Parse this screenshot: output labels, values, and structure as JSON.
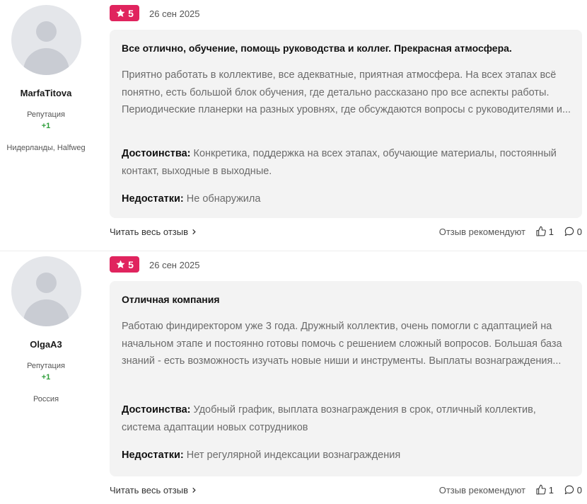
{
  "colors": {
    "badge": "#e0245e",
    "card_bg": "#f3f3f3",
    "reputation": "#2e9e3a"
  },
  "reviews": [
    {
      "author": "MarfaTitova",
      "reputation_label": "Репутация",
      "reputation_value": "+1",
      "location": "Нидерланды, Halfweg",
      "rating": "5",
      "date": "26 сен 2025",
      "title": "Все отлично, обучение, помощь руководства и коллег. Прекрасная атмосфера.",
      "text": "Приятно работать в коллективе, все адекватные, приятная атмосфера. На всех этапах всё понятно, есть большой блок обучения, где детально рассказано про все аспекты работы. Периодические планерки на разных уровнях, где обсуждаются вопросы с руководителями и...",
      "pros_label": "Достоинства:",
      "pros": "Конкретика, поддержка на всех этапах, обучающие материалы, постоянный контакт, выходные в выходные.",
      "cons_label": "Недостатки:",
      "cons": "Не обнаружила",
      "read_more": "Читать весь отзыв",
      "recommend": "Отзыв рекомендуют",
      "likes": "1",
      "comments": "0"
    },
    {
      "author": "OlgaA3",
      "reputation_label": "Репутация",
      "reputation_value": "+1",
      "location": "Россия",
      "rating": "5",
      "date": "26 сен 2025",
      "title": "Отличная компания",
      "text": "Работаю финдиректором уже 3 года. Дружный коллектив, очень помогли с адаптацией на начальном этапе и постоянно готовы помочь с решением сложный вопросов. Большая база знаний - есть возможность изучать новые ниши и инструменты. Выплаты вознаграждения...",
      "pros_label": "Достоинства:",
      "pros": "Удобный график, выплата вознаграждения в срок, отличный коллектив, система адаптации новых сотрудников",
      "cons_label": "Недостатки:",
      "cons": "Нет регулярной индексации вознаграждения",
      "read_more": "Читать весь отзыв",
      "recommend": "Отзыв рекомендуют",
      "likes": "1",
      "comments": "0"
    }
  ]
}
